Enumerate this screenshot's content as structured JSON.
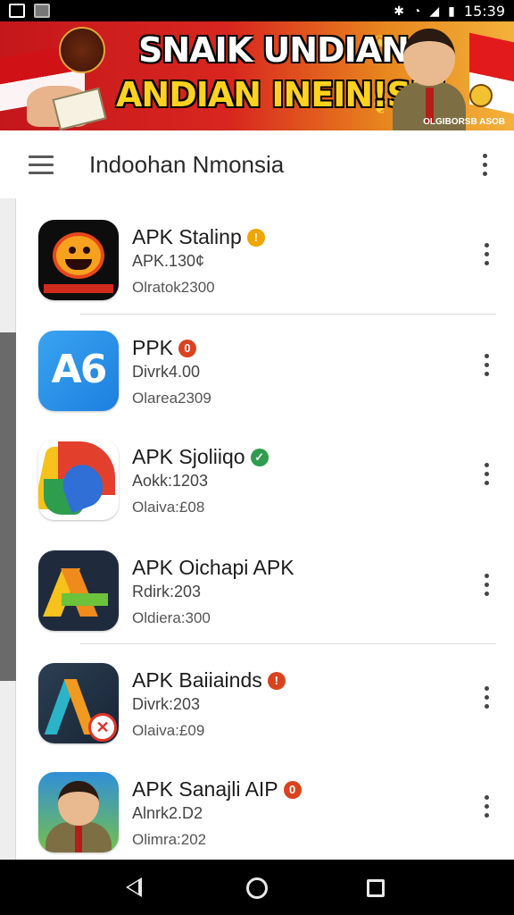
{
  "status_bar": {
    "time": "15:39",
    "icons": [
      "image-notification-icon",
      "photo-notification-icon",
      "bluetooth-icon",
      "wifi-icon",
      "signal-icon",
      "battery-icon"
    ]
  },
  "banner": {
    "line1": "SNAIK UNDIAN",
    "line2": "ANDIAN INEIN!SF!",
    "caption": "OLGIBORSB ASOB",
    "colors": {
      "background": "#d9261f",
      "headline_outline": "#000000",
      "line2": "#ffd21f"
    }
  },
  "app_bar": {
    "title": "Indoohan Nmonsia",
    "menu_icon": "menu-icon",
    "overflow_icon": "more-vertical-icon"
  },
  "apps": [
    {
      "name": "APK Stalinp",
      "badge": "!",
      "badge_color": "#f0a500",
      "sub": "APK.130¢",
      "date": "Olratok2300",
      "icon": "flame-mascot-icon"
    },
    {
      "name": "PPK",
      "badge": "0",
      "badge_color": "#d9431e",
      "sub": "Divrk4.00",
      "date": "Olarea2309",
      "icon": "a6-icon"
    },
    {
      "name": "APK Sjoliiqo",
      "badge": "✓",
      "badge_color": "#2e9d4d",
      "sub": "Aokk:1203",
      "date": "Olaiva:£08",
      "icon": "colorful-swirl-icon"
    },
    {
      "name": "APK Oichapi APK",
      "badge": "",
      "badge_color": "",
      "sub": "Rdirk:203",
      "date": "Oldiera:300",
      "icon": "letter-a-icon"
    },
    {
      "name": "APK Baiiainds",
      "badge": "!",
      "badge_color": "#d9431e",
      "sub": "Divrk:203",
      "date": "Olaiva:£09",
      "icon": "a-with-x-icon"
    },
    {
      "name": "APK Sanajli AIP",
      "badge": "0",
      "badge_color": "#d9431e",
      "sub": "Alnrk2.D2",
      "date": "Olimra:202",
      "icon": "officer-portrait-icon"
    }
  ],
  "nav_bar": {
    "back": "back-icon",
    "home": "home-icon",
    "recents": "recents-icon"
  }
}
